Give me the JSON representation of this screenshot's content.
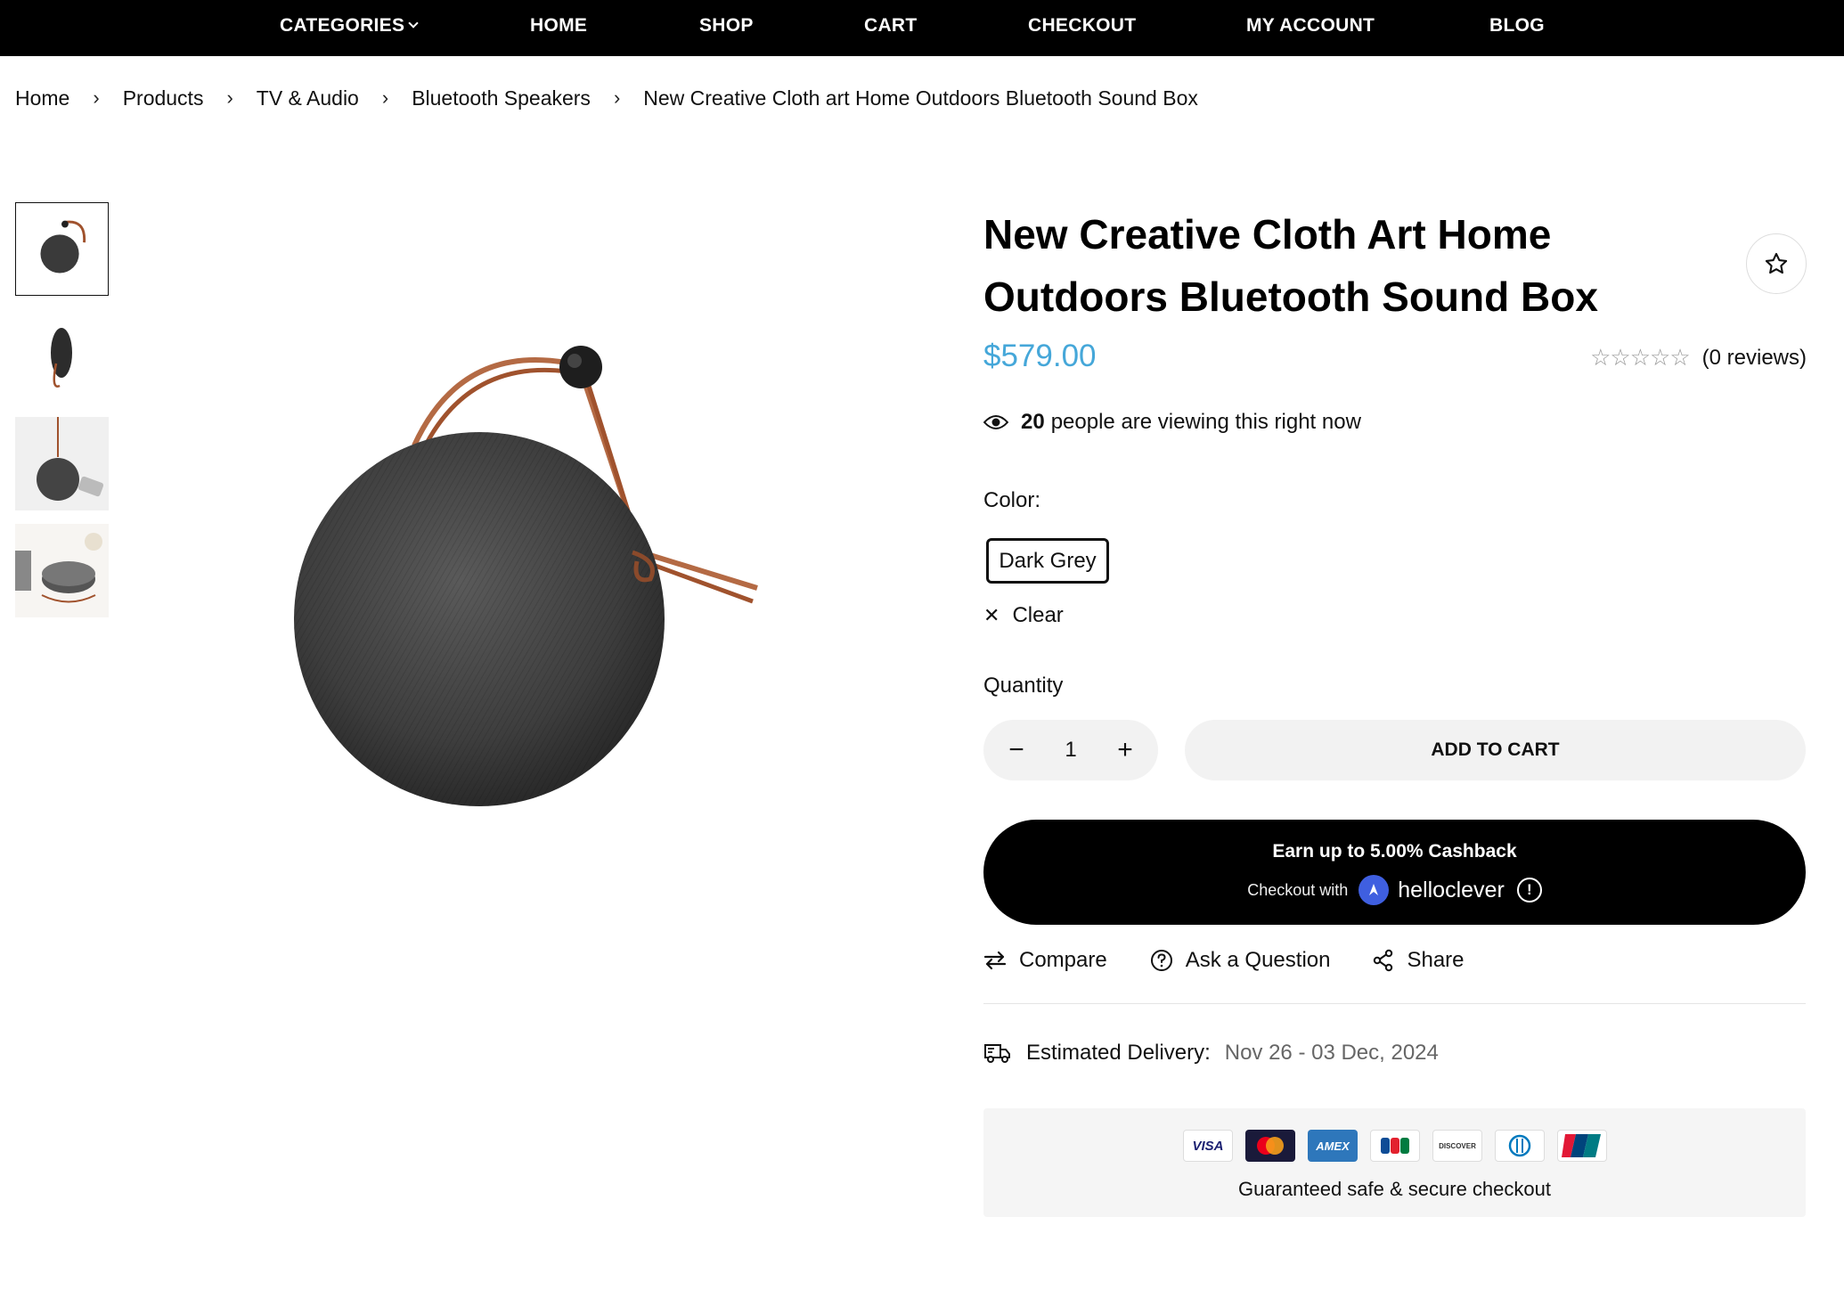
{
  "nav": {
    "items": [
      {
        "label": "CATEGORIES",
        "has_dropdown": true
      },
      {
        "label": "HOME"
      },
      {
        "label": "SHOP"
      },
      {
        "label": "CART"
      },
      {
        "label": "CHECKOUT"
      },
      {
        "label": "MY ACCOUNT"
      },
      {
        "label": "BLOG"
      }
    ]
  },
  "breadcrumb": {
    "items": [
      "Home",
      "Products",
      "TV & Audio",
      "Bluetooth Speakers",
      "New Creative Cloth art Home Outdoors Bluetooth Sound Box"
    ],
    "separator": "›"
  },
  "gallery": {
    "thumbnails": [
      {
        "name": "thumbnail-front",
        "active": true
      },
      {
        "name": "thumbnail-side",
        "active": false
      },
      {
        "name": "thumbnail-hanging",
        "active": false
      },
      {
        "name": "thumbnail-lifestyle",
        "active": false
      }
    ]
  },
  "product": {
    "title": "New Creative Cloth Art Home Outdoors Bluetooth Sound Box",
    "price": "$579.00",
    "price_color": "#45a7d9",
    "stars": "☆☆☆☆☆",
    "rating": 0,
    "reviews_text": "(0 reviews)",
    "viewing_count": "20",
    "viewing_text": "people are viewing this right now",
    "color_label": "Color:",
    "color_selected": "Dark Grey",
    "clear_label": "Clear",
    "quantity_label": "Quantity",
    "quantity_value": "1",
    "add_to_cart_label": "ADD TO CART"
  },
  "cashback": {
    "headline": "Earn up to 5.00% Cashback",
    "checkout_with": "Checkout with",
    "brand": "helloclever",
    "info_glyph": "!"
  },
  "actions": {
    "compare": "Compare",
    "ask": "Ask a Question",
    "share": "Share"
  },
  "delivery": {
    "label": "Estimated Delivery:",
    "date": "Nov 26 - 03 Dec, 2024"
  },
  "secure": {
    "cards": [
      "VISA",
      "MC",
      "AMEX",
      "JCB",
      "DISCOVER",
      "DINERS",
      "UnionPay"
    ],
    "guarantee": "Guaranteed safe & secure checkout"
  }
}
